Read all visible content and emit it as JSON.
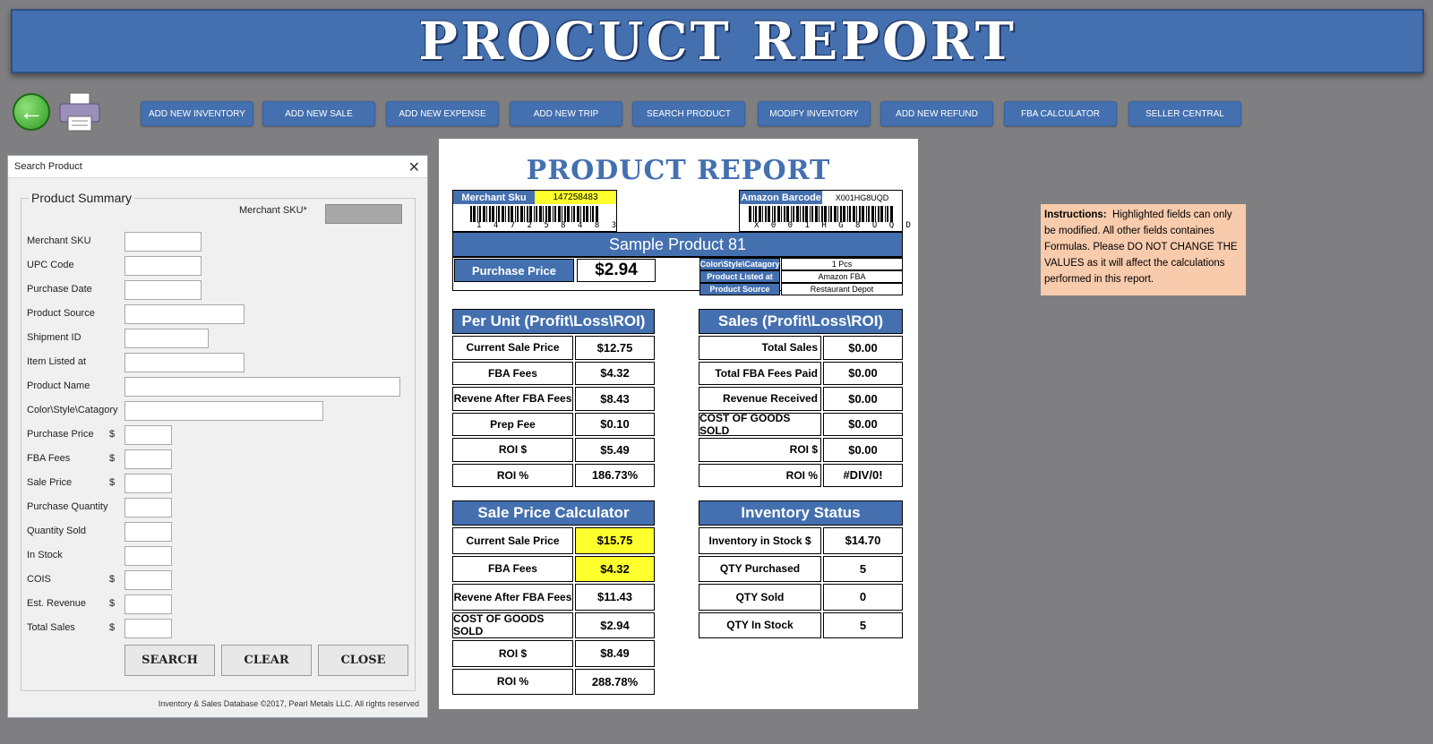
{
  "banner": {
    "title": "PROCUCT REPORT"
  },
  "toolbar": {
    "buttons": [
      "ADD NEW INVENTORY",
      "ADD NEW SALE",
      "ADD NEW EXPENSE",
      "ADD NEW TRIP",
      "SEARCH PRODUCT",
      "MODIFY INVENTORY",
      "ADD NEW REFUND",
      "FBA CALCULATOR",
      "SELLER CENTRAL"
    ]
  },
  "dialog": {
    "title": "Search Product",
    "close_glyph": "✕",
    "group_label": "Product Summary",
    "merchant_sku_required_label": "Merchant SKU*",
    "fields": [
      {
        "label": "Merchant SKU",
        "dollar": "",
        "value": ""
      },
      {
        "label": "UPC Code",
        "dollar": "",
        "value": ""
      },
      {
        "label": "Purchase Date",
        "dollar": "",
        "value": ""
      },
      {
        "label": "Product Source",
        "dollar": "",
        "value": ""
      },
      {
        "label": "Shipment ID",
        "dollar": "",
        "value": ""
      },
      {
        "label": "Item Listed at",
        "dollar": "",
        "value": ""
      },
      {
        "label": "Product Name",
        "dollar": "",
        "value": ""
      },
      {
        "label": "Color\\Style\\Catagory",
        "dollar": "",
        "value": ""
      },
      {
        "label": "Purchase Price",
        "dollar": "$",
        "value": ""
      },
      {
        "label": "FBA Fees",
        "dollar": "$",
        "value": ""
      },
      {
        "label": "Sale Price",
        "dollar": "$",
        "value": ""
      },
      {
        "label": "Purchase Quantity",
        "dollar": "",
        "value": ""
      },
      {
        "label": "Quantity Sold",
        "dollar": "",
        "value": ""
      },
      {
        "label": "In Stock",
        "dollar": "",
        "value": ""
      },
      {
        "label": "COIS",
        "dollar": "$",
        "value": ""
      },
      {
        "label": "Est. Revenue",
        "dollar": "$",
        "value": ""
      },
      {
        "label": "Total Sales",
        "dollar": "$",
        "value": ""
      }
    ],
    "buttons": {
      "search": "SEARCH",
      "clear": "CLEAR",
      "close": "CLOSE"
    },
    "copyright": "Inventory & Sales Database ©2017, Pearl Metals LLC. All rights reserved"
  },
  "report": {
    "title": "PRODUCT REPORT",
    "merchant_sku_label": "Merchant Sku",
    "merchant_sku_value": "147258483",
    "merchant_sku_digits": "1 4 7 2 5 8 4 8 3",
    "amazon_barcode_label": "Amazon Barcode",
    "amazon_barcode_value": "X001HG8UQD",
    "amazon_barcode_digits": "X 0 0 1 H G 8 U Q D",
    "product_name": "Sample Product 81",
    "purchase_price_label": "Purchase Price",
    "purchase_price_value": "$2.94",
    "details": [
      {
        "label": "Color\\Style\\Catagory",
        "value": "1 Pcs"
      },
      {
        "label": "Product Listed at",
        "value": "Amazon FBA"
      },
      {
        "label": "Product Source",
        "value": "Restaurant Depot"
      }
    ],
    "per_unit": {
      "title": "Per Unit (Profit\\Loss\\ROI)",
      "rows": [
        {
          "label": "Current Sale Price",
          "value": "$12.75"
        },
        {
          "label": "FBA Fees",
          "value": "$4.32"
        },
        {
          "label": "Revene After FBA Fees",
          "value": "$8.43"
        },
        {
          "label": "Prep Fee",
          "value": "$0.10"
        },
        {
          "label": "ROI $",
          "value": "$5.49"
        },
        {
          "label": "ROI %",
          "value": "186.73%"
        }
      ]
    },
    "sales": {
      "title": "Sales (Profit\\Loss\\ROI)",
      "rows": [
        {
          "label": "Total Sales",
          "value": "$0.00"
        },
        {
          "label": "Total FBA Fees Paid",
          "value": "$0.00"
        },
        {
          "label": "Revenue Received",
          "value": "$0.00"
        },
        {
          "label": "COST OF GOODS SOLD",
          "value": "$0.00"
        },
        {
          "label": "ROI $",
          "value": "$0.00"
        },
        {
          "label": "ROI %",
          "value": "#DIV/0!"
        }
      ]
    },
    "calculator": {
      "title": "Sale Price Calculator",
      "rows": [
        {
          "label": "Current Sale Price",
          "value": "$15.75"
        },
        {
          "label": "FBA Fees",
          "value": "$4.32"
        },
        {
          "label": "Revene After FBA Fees",
          "value": "$11.43"
        },
        {
          "label": "COST OF GOODS SOLD",
          "value": "$2.94"
        },
        {
          "label": "ROI $",
          "value": "$8.49"
        },
        {
          "label": "ROI %",
          "value": "288.78%"
        }
      ]
    },
    "inventory": {
      "title": "Inventory Status",
      "rows": [
        {
          "label": "Inventory in Stock $",
          "value": "$14.70"
        },
        {
          "label": "QTY Purchased",
          "value": "5"
        },
        {
          "label": "QTY Sold",
          "value": "0"
        },
        {
          "label": "QTY In Stock",
          "value": "5"
        }
      ]
    }
  },
  "instructions": {
    "heading": "Instructions:",
    "text": "Highlighted fields can only be modified. All other fields containes Formulas. Please DO NOT CHANGE THE VALUES as it will affect the calculations performed in this report."
  },
  "colors": {
    "accent": "#4470b0",
    "background": "#7f7f81",
    "highlight": "#ffff2e",
    "instructions_bg": "#f8cbad"
  }
}
